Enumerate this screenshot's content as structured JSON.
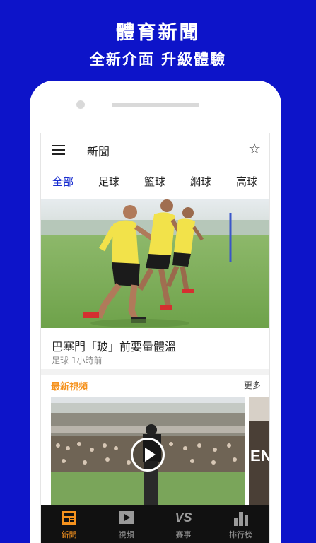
{
  "promo": {
    "title": "體育新聞",
    "subtitle": "全新介面  升級體驗"
  },
  "appbar": {
    "title": "新聞"
  },
  "tabs": [
    {
      "label": "全部",
      "active": true
    },
    {
      "label": "足球",
      "active": false
    },
    {
      "label": "籃球",
      "active": false
    },
    {
      "label": "網球",
      "active": false
    },
    {
      "label": "高球",
      "active": false
    }
  ],
  "article": {
    "title": "巴塞門「玻」前要量體溫",
    "meta": "足球 1小時前"
  },
  "video_section": {
    "title": "最新視頻",
    "more": "更多",
    "side_caption": "EN"
  },
  "bottom_nav": [
    {
      "label": "新聞",
      "icon": "news-icon",
      "active": true
    },
    {
      "label": "視頻",
      "icon": "video-icon",
      "active": false
    },
    {
      "label": "賽事",
      "icon": "vs-icon",
      "active": false,
      "icon_text": "VS"
    },
    {
      "label": "排行榜",
      "icon": "bar-chart-icon",
      "active": false
    }
  ],
  "colors": {
    "background": "#0d14c9",
    "accent": "#1a2fd0",
    "orange": "#f5921e",
    "nav_bg": "#111111"
  }
}
